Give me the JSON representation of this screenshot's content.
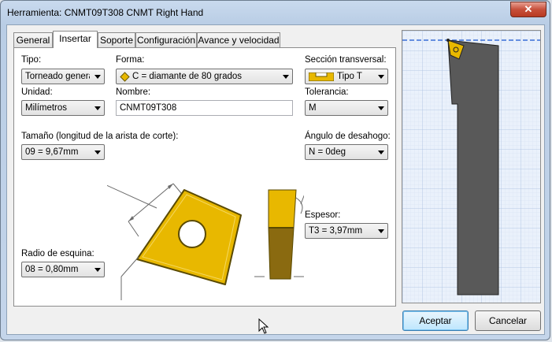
{
  "window": {
    "title": "Herramienta: CNMT09T308 CNMT Right Hand",
    "close_glyph": "✕"
  },
  "tabs": [
    {
      "label": "General"
    },
    {
      "label": "Insertar"
    },
    {
      "label": "Soporte"
    },
    {
      "label": "Configuración"
    },
    {
      "label": "Avance y velocidad"
    }
  ],
  "active_tab": "Insertar",
  "form": {
    "tipo": {
      "label": "Tipo:",
      "value": "Torneado genera"
    },
    "forma": {
      "label": "Forma:",
      "value": "C = diamante de 80 grados",
      "icon": "diamond-shape-icon"
    },
    "seccion": {
      "label": "Sección transversal:",
      "value": "Tipo T",
      "icon": "cross-section-icon"
    },
    "unidad": {
      "label": "Unidad:",
      "value": "Milímetros"
    },
    "nombre": {
      "label": "Nombre:",
      "value": "CNMT09T308"
    },
    "tolerancia": {
      "label": "Tolerancia:",
      "value": "M"
    },
    "tamano": {
      "label": "Tamaño (longitud de la arista de corte):",
      "value": "09 = 9,67mm"
    },
    "angulo": {
      "label": "Ángulo de desahogo:",
      "value": "N = 0deg"
    },
    "espesor": {
      "label": "Espesor:",
      "value": "T3 = 3,97mm"
    },
    "radio": {
      "label": "Radio de esquina:",
      "value": "08 = 0,80mm"
    }
  },
  "buttons": {
    "ok": "Aceptar",
    "cancel": "Cancelar"
  },
  "colors": {
    "insert": "#e8b800",
    "insert_edge": "#6b5a00",
    "holder": "#595959",
    "preview_grid": "#b9cbe6",
    "axis_line": "#3a6fd8"
  }
}
